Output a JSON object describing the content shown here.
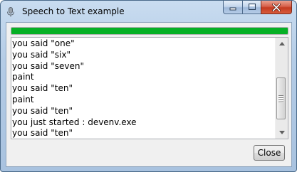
{
  "window": {
    "title": "Speech to Text example",
    "icon": "microphone-icon"
  },
  "caption_buttons": {
    "minimize_icon": "minimize-icon",
    "maximize_icon": "maximize-icon",
    "close_icon": "close-icon"
  },
  "progress": {
    "value": 1.0,
    "color": "#06b025"
  },
  "log": {
    "lines": [
      "you said \"one\"",
      "you said \"six\"",
      "you said \"seven\"",
      "paint",
      "you said \"ten\"",
      "paint",
      "you said \"ten\"",
      "you just started : devenv.exe",
      "you said \"ten\""
    ]
  },
  "footer": {
    "close_label": "Close"
  }
}
